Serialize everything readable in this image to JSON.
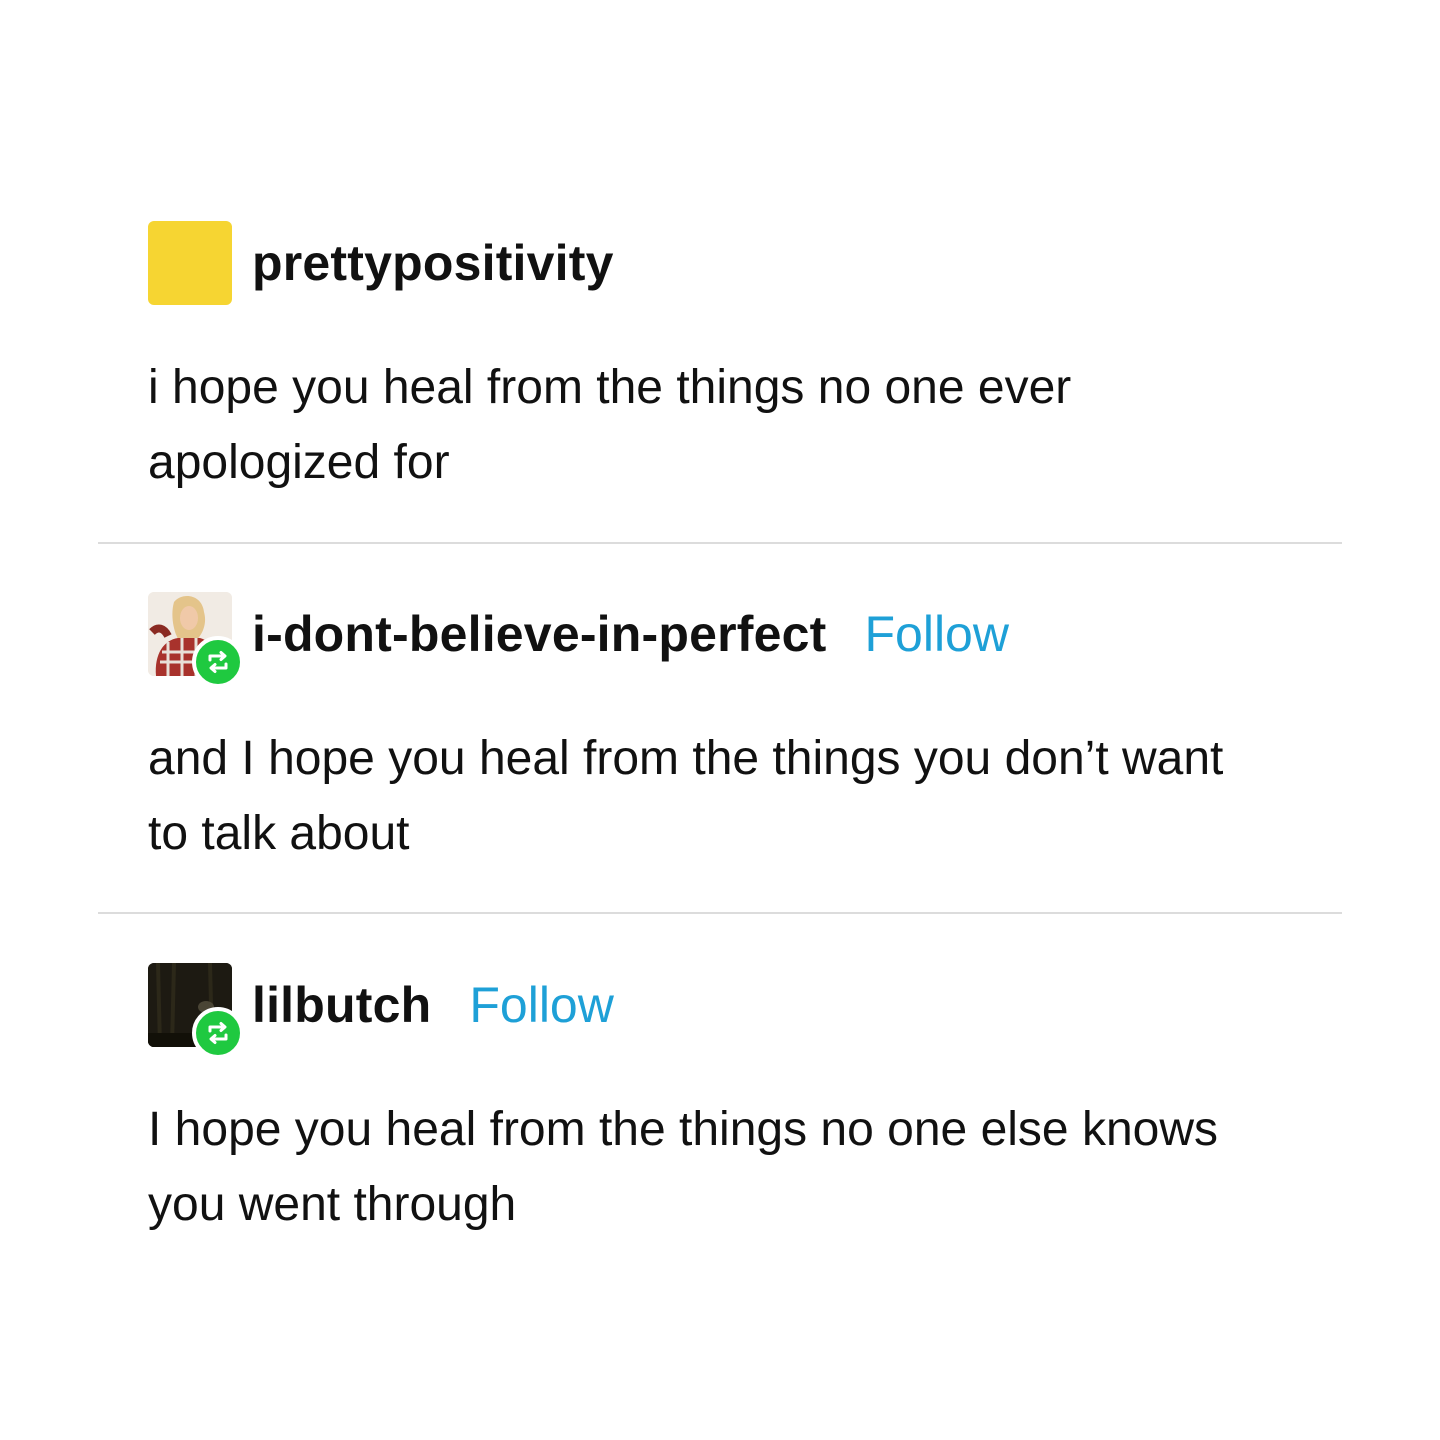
{
  "posts": [
    {
      "username": "prettypositivity",
      "avatar": "yellow-square-avatar",
      "body": "i hope you heal from the things no one ever apologized for"
    },
    {
      "username": "i-dont-believe-in-perfect",
      "follow_label": "Follow",
      "avatar": "photo-avatar",
      "reblog_icon": "reblog-icon",
      "body": "and I hope you heal from the things you don’t want to talk about"
    },
    {
      "username": "lilbutch",
      "follow_label": "Follow",
      "avatar": "photo-avatar",
      "reblog_icon": "reblog-icon",
      "body": "I hope you heal from the things no one else knows you went through"
    }
  ],
  "colors": {
    "follow": "#1ea0d7",
    "reblog_badge": "#1fc940",
    "avatar_yellow": "#f6d532",
    "divider": "#dcdcdc"
  }
}
